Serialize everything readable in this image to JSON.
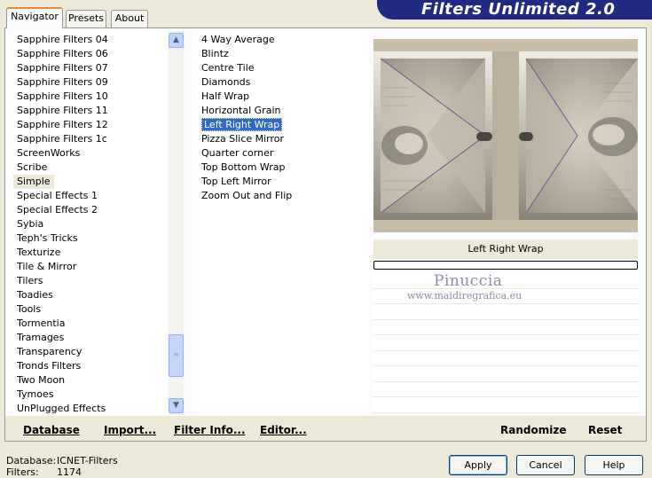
{
  "tabs": [
    {
      "label": "Navigator"
    },
    {
      "label": "Presets"
    },
    {
      "label": "About"
    }
  ],
  "banner": "Filters Unlimited 2.0",
  "categories": [
    "Sapphire Filters 04",
    "Sapphire Filters 06",
    "Sapphire Filters 07",
    "Sapphire Filters 09",
    "Sapphire Filters 10",
    "Sapphire Filters 11",
    "Sapphire Filters 12",
    "Sapphire Filters 1c",
    "ScreenWorks",
    "Scribe",
    "Simple",
    "Special Effects 1",
    "Special Effects 2",
    "Sybia",
    "Teph's Tricks",
    "Texturize",
    "Tile & Mirror",
    "Tilers",
    "Toadies",
    "Tools",
    "Tormentia",
    "Tramages",
    "Transparency",
    "Tronds Filters",
    "Two Moon",
    "Tymoes",
    "UnPlugged Effects"
  ],
  "selected_category": "Simple",
  "filters": [
    "4 Way Average",
    "Blintz",
    "Centre Tile",
    "Diamonds",
    "Half Wrap",
    "Horizontal Grain",
    "Left Right Wrap",
    "Pizza Slice Mirror",
    "Quarter corner",
    "Top Bottom Wrap",
    "Top Left Mirror",
    "Zoom Out and Flip"
  ],
  "selected_filter": "Left Right Wrap",
  "preview_filter_name": "Left Right Wrap",
  "watermark": {
    "title": "Pinuccia",
    "url": "www.maidiregrafica.eu"
  },
  "buttons": {
    "database": "Database",
    "import": "Import...",
    "filter_info": "Filter Info...",
    "editor": "Editor...",
    "randomize": "Randomize",
    "reset": "Reset",
    "apply": "Apply",
    "cancel": "Cancel",
    "help": "Help"
  },
  "status": {
    "database_label": "Database:",
    "database_value": "ICNET-Filters",
    "filters_label": "Filters:",
    "filters_value": "1174"
  },
  "colors": {
    "accent": "#316ac5",
    "banner": "#1f2a80",
    "tab_highlight": "#e68b2c"
  }
}
